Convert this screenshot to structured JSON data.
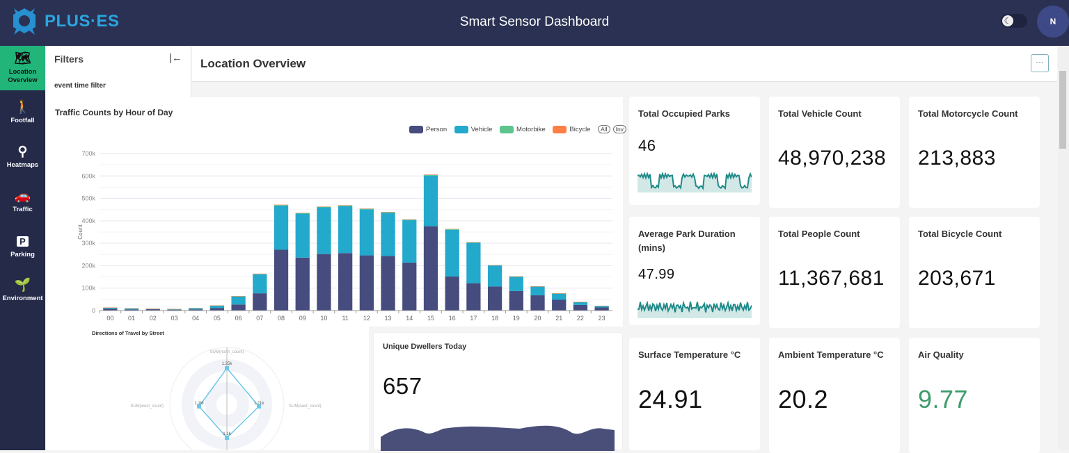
{
  "header": {
    "logo": "PLUS·ES",
    "title": "Smart Sensor Dashboard",
    "avatar": "N",
    "theme_icon": "moon-icon"
  },
  "sidebar": {
    "items": [
      {
        "label": "Location Overview",
        "icon": "map-pin-icon",
        "active": true
      },
      {
        "label": "Footfall",
        "icon": "walking-icon"
      },
      {
        "label": "Heatmaps",
        "icon": "route-icon"
      },
      {
        "label": "Traffic",
        "icon": "car-icon"
      },
      {
        "label": "Parking",
        "icon": "parking-icon"
      },
      {
        "label": "Environment",
        "icon": "sprout-icon"
      }
    ]
  },
  "filters": {
    "title": "Filters",
    "event_time_label": "event time filter"
  },
  "main": {
    "title": "Location Overview",
    "more": "···"
  },
  "kpis": [
    {
      "title": "Total Occupied Parks",
      "value": "46"
    },
    {
      "title": "Total Vehicle Count",
      "value": "48,970,238"
    },
    {
      "title": "Total Motorcycle Count",
      "value": "213,883"
    },
    {
      "title": "Average Park Duration (mins)",
      "value": "47.99"
    },
    {
      "title": "Total People Count",
      "value": "11,367,681"
    },
    {
      "title": "Total Bicycle Count",
      "value": "203,671"
    },
    {
      "title": "Surface Temperature °C",
      "value": "24.91"
    },
    {
      "title": "Ambient Temperature °C",
      "value": "20.2"
    },
    {
      "title": "Air Quality",
      "value": "9.77",
      "color": "#3d9b6a"
    }
  ],
  "dwellers": {
    "title": "Unique Dwellers Today",
    "value": "657"
  },
  "radar": {
    "title": "Directions of Travel by Street",
    "axes": [
      "SUM(north_count)",
      "SUM(west_count)",
      "SUM(east_count)"
    ],
    "values": [
      "1.25k",
      "1.1M",
      "1.21k",
      "1.1k"
    ]
  },
  "colors": {
    "person": "#464c7e",
    "vehicle": "#22a9cc",
    "motorbike": "#5cc48c",
    "bicycle": "#ff7f45",
    "spark": "#1e8a88"
  },
  "chart_data": {
    "type": "bar",
    "stacked": true,
    "title": "Traffic Counts by Hour of Day",
    "ylabel": "Count",
    "ylim": [
      0,
      700000
    ],
    "yticks": [
      "0",
      "100k",
      "200k",
      "300k",
      "400k",
      "500k",
      "600k",
      "700k"
    ],
    "legend": [
      "Person",
      "Vehicle",
      "Motorbike",
      "Bicycle"
    ],
    "legend_buttons": [
      "All",
      "Inv"
    ],
    "categories": [
      "00",
      "01",
      "02",
      "03",
      "04",
      "05",
      "06",
      "07",
      "08",
      "09",
      "10",
      "11",
      "12",
      "13",
      "14",
      "15",
      "16",
      "17",
      "18",
      "19",
      "20",
      "21",
      "22",
      "23"
    ],
    "series": [
      {
        "name": "Person",
        "values": [
          8000,
          5000,
          6000,
          4000,
          5000,
          11000,
          27000,
          77000,
          271000,
          236000,
          252000,
          256000,
          246000,
          243000,
          214000,
          376000,
          152000,
          122000,
          107000,
          87000,
          68000,
          48000,
          25000,
          14000
        ]
      },
      {
        "name": "Vehicle",
        "values": [
          5000,
          5000,
          2000,
          3000,
          6000,
          11000,
          36000,
          85000,
          197000,
          196000,
          208000,
          210000,
          205000,
          193000,
          189000,
          226000,
          208000,
          180000,
          94000,
          64000,
          39000,
          28000,
          13000,
          7000
        ]
      },
      {
        "name": "Motorbike",
        "values": [
          300,
          200,
          200,
          200,
          300,
          500,
          1000,
          1500,
          2500,
          2500,
          2500,
          2500,
          2500,
          2500,
          2500,
          3000,
          2500,
          2000,
          1500,
          1000,
          700,
          500,
          300,
          200
        ]
      },
      {
        "name": "Bicycle",
        "values": [
          200,
          100,
          100,
          100,
          200,
          400,
          800,
          1200,
          1500,
          1500,
          1500,
          1500,
          1500,
          1500,
          1500,
          1800,
          1500,
          1200,
          900,
          700,
          500,
          300,
          200,
          100
        ]
      }
    ]
  }
}
